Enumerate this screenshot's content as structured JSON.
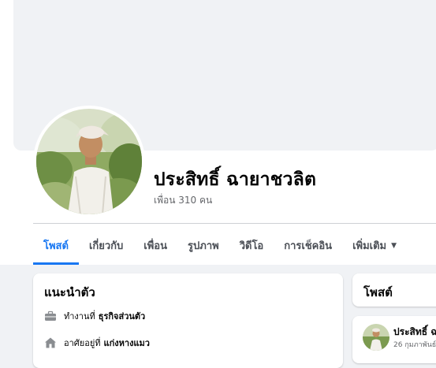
{
  "profile": {
    "name": "ประสิทธิ์ ฉายาชวลิต",
    "friends_text": "เพื่อน 310 คน"
  },
  "tabs": [
    {
      "label": "โพสต์",
      "active": true
    },
    {
      "label": "เกี่ยวกับ",
      "active": false
    },
    {
      "label": "เพื่อน",
      "active": false
    },
    {
      "label": "รูปภาพ",
      "active": false
    },
    {
      "label": "วิดีโอ",
      "active": false
    },
    {
      "label": "การเช็คอิน",
      "active": false
    },
    {
      "label": "เพิ่มเติม",
      "active": false
    }
  ],
  "intro": {
    "title": "แนะนำตัว",
    "work_prefix": "ทำงานที่",
    "work_value": "ธุรกิจส่วนตัว",
    "home_prefix": "อาศัยอยู่ที่",
    "home_value": "แก่งหางแมว"
  },
  "posts": {
    "title": "โพสต์",
    "first_author": "ประสิทธิ์ ฉ",
    "first_date": "26 กุมภาพันธ์"
  },
  "icons": {
    "work": "briefcase-icon",
    "home": "home-icon",
    "more": "caret-down-icon"
  },
  "colors": {
    "accent": "#1877f2",
    "background": "#f0f2f5",
    "muted_text": "#65676b"
  }
}
